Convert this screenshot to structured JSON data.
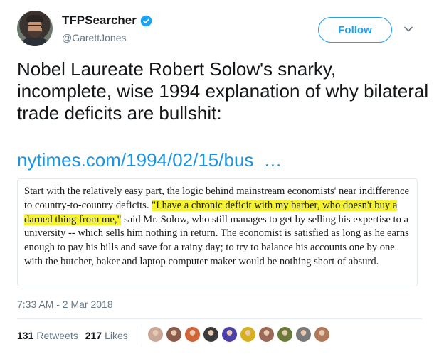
{
  "user": {
    "display_name": "TFPSearcher",
    "handle": "@GarettJones"
  },
  "follow_label": "Follow",
  "tweet": {
    "text": "Nobel Laureate Robert Solow's snarky, incomplete, wise 1994 explanation of why bilateral trade deficits are bullshit:",
    "link": "nytimes.com/1994/02/15/bus",
    "link_ellipsis": "…"
  },
  "quote": {
    "part1": "Start with the relatively easy part, the logic behind mainstream economists' near indifference to country-to-country deficits. ",
    "highlight": "\"I have a chronic deficit with my barber, who doesn't buy a darned thing from me,\"",
    "part2": " said Mr. Solow, who still manages to get by selling his expertise to a university -- which sells him nothing in return. The economist is satisfied as long as he earns enough to pay his bills and save for a rainy day; to try to balance his accounts one by one with the butcher, baker and laptop computer maker would be nothing short of absurd.",
    "highlight_color": "#f6f32c"
  },
  "timestamp": "7:33 AM - 2 Mar 2018",
  "stats": {
    "retweets_count": "131",
    "retweets_label": "Retweets",
    "likes_count": "217",
    "likes_label": "Likes"
  },
  "likers": [
    {
      "name": "liker-avatar-1",
      "color": "#c9a89a"
    },
    {
      "name": "liker-avatar-2",
      "color": "#8a5a4a"
    },
    {
      "name": "liker-avatar-3",
      "color": "#d0653a"
    },
    {
      "name": "liker-avatar-4",
      "color": "#3a3a3a"
    },
    {
      "name": "liker-avatar-5",
      "color": "#4b3fa8"
    },
    {
      "name": "liker-avatar-6",
      "color": "#d6b020"
    },
    {
      "name": "liker-avatar-7",
      "color": "#9b6a58"
    },
    {
      "name": "liker-avatar-8",
      "color": "#6b7a3a"
    },
    {
      "name": "liker-avatar-9",
      "color": "#7a7a7a"
    },
    {
      "name": "liker-avatar-10",
      "color": "#b07a5a"
    }
  ],
  "colors": {
    "accent": "#1da1f2",
    "link": "#1b95e0",
    "muted": "#657786"
  }
}
